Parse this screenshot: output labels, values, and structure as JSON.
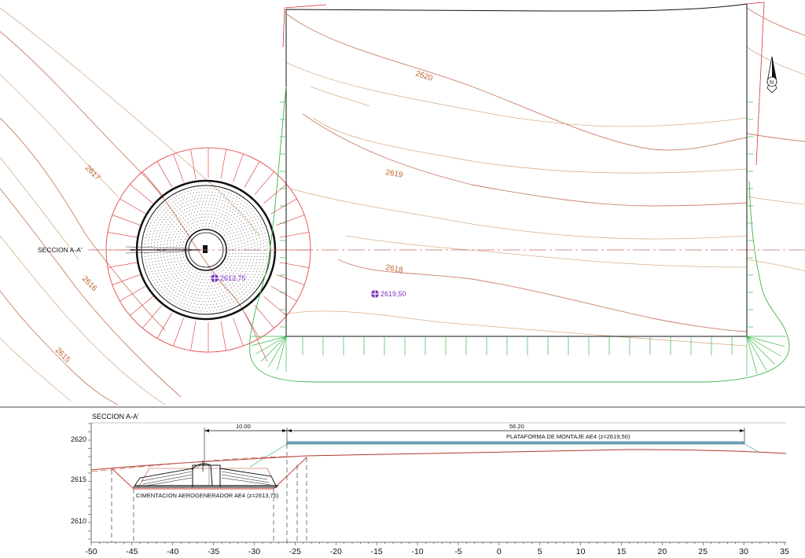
{
  "plan": {
    "contours": [
      "2620",
      "2619",
      "2618",
      "2617",
      "2616",
      "2615"
    ],
    "section_label": "SECCION A-A'",
    "spot_levels": [
      "2613,75",
      "2619,50"
    ],
    "north_symbol": "N"
  },
  "profile": {
    "title": "SECCION A-A'",
    "dim_left": "10.00",
    "dim_right": "56.20",
    "platform_label": "PLATAFORMA DE MONTAJE AE4 (z=2619,50)",
    "foundation_label": "CIMENTACION AEROGENERADOR AE4 (z=2613,75)",
    "y_ticks": [
      "2620",
      "2615",
      "2610"
    ],
    "x_ticks": [
      "-50",
      "-45",
      "-40",
      "-35",
      "-30",
      "-25",
      "-20",
      "-15",
      "-10",
      "-5",
      "0",
      "5",
      "10",
      "15",
      "20",
      "25",
      "30",
      "35"
    ]
  }
}
